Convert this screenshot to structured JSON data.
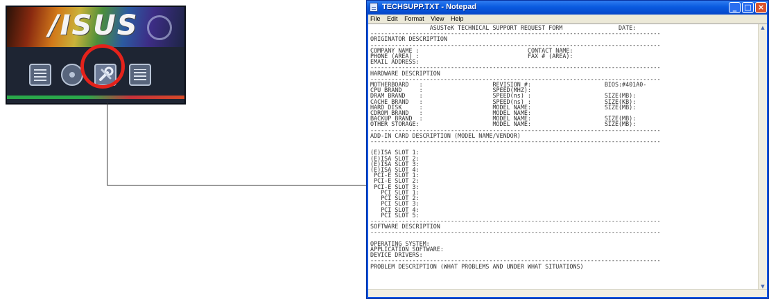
{
  "asus_panel": {
    "logo_text": "/ISUS"
  },
  "notepad": {
    "title": "TECHSUPP.TXT - Notepad",
    "menu": [
      "File",
      "Edit",
      "Format",
      "View",
      "Help"
    ],
    "content": [
      "                 ASUSTeK TECHNICAL SUPPORT REQUEST FORM                DATE:",
      "-----------------------------------------------------------------------------------",
      "ORIGINATOR DESCRIPTION",
      "-----------------------------------------------------------------------------------",
      "COMPANY NAME :                               CONTACT NAME:",
      "PHONE (AREA) :                               FAX # (AREA):",
      "EMAIL ADDRESS:",
      "-----------------------------------------------------------------------------------",
      "HARDWARE DESCRIPTION",
      "-----------------------------------------------------------------------------------",
      "MOTHERBOARD   :                    REVISION #:                     BIOS:#401A0-",
      "CPU BRAND     :                    SPEED(MHZ):",
      "DRAM BRAND    :                    SPEED(ns) :                     SIZE(MB):",
      "CACHE BRAND   :                    SPEED(ns) :                     SIZE(KB):",
      "HARD DISK     :                    MODEL NAME:                     SIZE(MB):",
      "CDROM BRAND   :                    MODEL NAME:",
      "BACKUP BRAND  :                    MODEL NAME:                     SIZE(MB):",
      "OTHER STORAGE:                     MODEL NAME:                     SIZE(MB):",
      "-----------------------------------------------------------------------------------",
      "ADD-IN CARD DESCRIPTION (MODEL NAME/VENDOR)",
      "-----------------------------------------------------------------------------------",
      "",
      "(E)ISA SLOT 1:",
      "(E)ISA SLOT 2:",
      "(E)ISA SLOT 3:",
      "(E)ISA SLOT 4:",
      " PCI-E SLOT 1:",
      " PCI-E SLOT 2:",
      " PCI-E SLOT 3:",
      "   PCI SLOT 1:",
      "   PCI SLOT 2:",
      "   PCI SLOT 3:",
      "   PCI SLOT 4:",
      "   PCI SLOT 5:",
      "-----------------------------------------------------------------------------------",
      "SOFTWARE DESCRIPTION",
      "-----------------------------------------------------------------------------------",
      "",
      "OPERATING SYSTEM:",
      "APPLICATION SOFTWARE:",
      "DEVICE DRIVERS:",
      "-----------------------------------------------------------------------------------",
      "PROBLEM DESCRIPTION (WHAT PROBLEMS AND UNDER WHAT SITUATIONS)"
    ]
  },
  "icons": {
    "specs": "system-info-icon",
    "disc": "drivers-cd-icon",
    "tools": "wrench-tools-icon",
    "notes": "documents-icon",
    "swirl": "asus-swirl-icon",
    "notepad": "notepad-icon"
  },
  "colors": {
    "highlight": "#e4221b",
    "titlebar": "#0a54e3",
    "panel_bg": "#1e2533"
  }
}
